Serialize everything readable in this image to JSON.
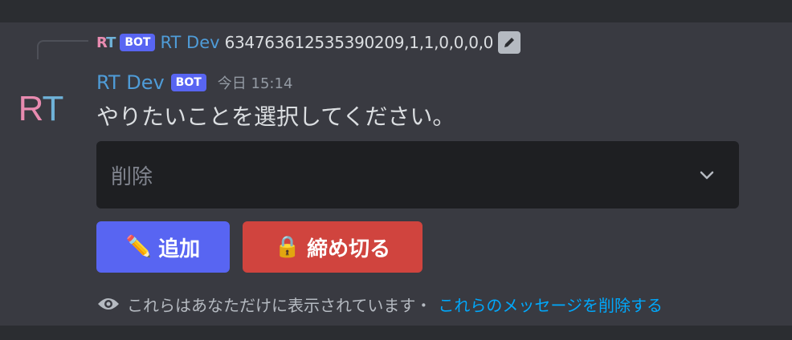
{
  "reply": {
    "avatar_r": "R",
    "avatar_t": "T",
    "badge": "BOT",
    "author": "RT Dev",
    "text": "634763612535390209,1,1,0,0,0,0",
    "edit_icon": "pencil-icon"
  },
  "message": {
    "avatar_r": "R",
    "avatar_t": "T",
    "author": "RT Dev",
    "badge": "BOT",
    "timestamp": "今日 15:14",
    "content": "やりたいことを選択してください。"
  },
  "select": {
    "value": "削除",
    "icon": "chevron-down-icon"
  },
  "buttons": {
    "add_emoji": "✏️",
    "add_label": "追加",
    "close_emoji": "🔒",
    "close_label": "締め切る"
  },
  "footer": {
    "icon": "eye-icon",
    "notice": "これらはあなただけに表示されています・",
    "delete_link": "これらのメッセージを削除する"
  },
  "colors": {
    "background": "#2b2d31",
    "message_bg": "#393a41",
    "bot_badge": "#5865f2",
    "author": "#4f9cd8",
    "button_primary": "#5865f2",
    "button_danger": "#d0443e",
    "link": "#00a8fc"
  }
}
